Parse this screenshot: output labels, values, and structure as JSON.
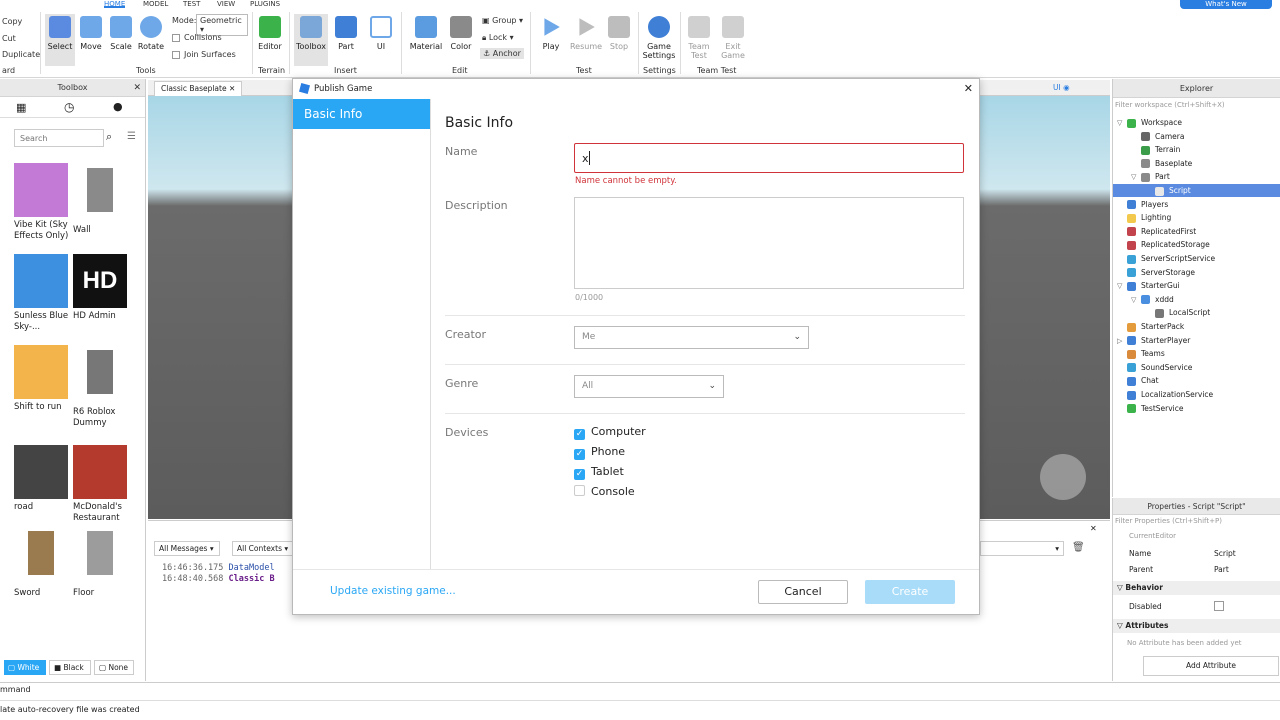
{
  "ribbon": {
    "tabs": [
      "HOME",
      "MODEL",
      "TEST",
      "VIEW",
      "PLUGINS"
    ],
    "whats_new": "What's New",
    "clipboard": {
      "copy": "Copy",
      "cut": "Cut",
      "duplicate": "Duplicate",
      "group_label": "ard"
    },
    "tools": {
      "select": "Select",
      "move": "Move",
      "scale": "Scale",
      "rotate": "Rotate",
      "mode_label": "Mode:",
      "mode_value": "Geometric",
      "collisions": "Collisions",
      "join_surfaces": "Join Surfaces",
      "group_label": "Tools"
    },
    "terrain": {
      "editor": "Editor",
      "group_label": "Terrain"
    },
    "insert": {
      "toolbox": "Toolbox",
      "part": "Part",
      "ui": "UI",
      "group_label": "Insert"
    },
    "edit": {
      "material": "Material",
      "color": "Color",
      "group": "Group",
      "lock": "Lock",
      "anchor": "Anchor",
      "group_label": "Edit"
    },
    "test": {
      "play": "Play",
      "resume": "Resume",
      "stop": "Stop",
      "group_label": "Test"
    },
    "settings": {
      "game_settings": "Game Settings",
      "group_label": "Settings"
    },
    "team_test": {
      "team_test": "Team Test",
      "exit_game": "Exit Game",
      "group_label": "Team Test"
    }
  },
  "toolbox": {
    "title": "Toolbox",
    "search_placeholder": "Search",
    "items": [
      {
        "label": "Vibe Kit (Sky Effects Only)",
        "color": "#c37ad6"
      },
      {
        "label": "Wall",
        "color": "#8a8a8a"
      },
      {
        "label": "Sunless Blue Sky-...",
        "color": "#3d8fe0"
      },
      {
        "label": "HD Admin",
        "color": "#111111"
      },
      {
        "label": "Shift to run",
        "color": "#f2b44b"
      },
      {
        "label": "R6 Roblox Dummy",
        "color": "#777777"
      },
      {
        "label": "road",
        "color": "#444444"
      },
      {
        "label": "McDonald's Restaurant",
        "color": "#b53a2e"
      },
      {
        "label": "Sword",
        "color": "#9a7b4f"
      },
      {
        "label": "Floor",
        "color": "#9c9c9c"
      }
    ],
    "hd_text": "HD",
    "bg_options": [
      "White",
      "Black",
      "None"
    ]
  },
  "viewport": {
    "tab_label": "Classic Baseplate",
    "ui_toggle": "UI"
  },
  "output": {
    "filter_messages": "All Messages",
    "filter_contexts": "All Contexts",
    "lines": [
      {
        "time": "16:46:36.175",
        "text": "DataModel"
      },
      {
        "time": "16:48:40.568",
        "text": "Classic B"
      }
    ]
  },
  "explorer": {
    "title": "Explorer",
    "filter_placeholder": "Filter workspace (Ctrl+Shift+X)",
    "items": [
      {
        "label": "Workspace",
        "depth": 0,
        "arrow": "▽",
        "color": "#3bb34a"
      },
      {
        "label": "Camera",
        "depth": 1,
        "arrow": "",
        "color": "#666666"
      },
      {
        "label": "Terrain",
        "depth": 1,
        "arrow": "",
        "color": "#3b9d4a"
      },
      {
        "label": "Baseplate",
        "depth": 1,
        "arrow": "",
        "color": "#8a8a8a"
      },
      {
        "label": "Part",
        "depth": 1,
        "arrow": "▽",
        "color": "#8a8a8a"
      },
      {
        "label": "Script",
        "depth": 2,
        "arrow": "",
        "color": "#e8e8e8",
        "selected": true
      },
      {
        "label": "Players",
        "depth": 0,
        "arrow": "",
        "color": "#3f7fd6"
      },
      {
        "label": "Lighting",
        "depth": 0,
        "arrow": "",
        "color": "#f2c94c"
      },
      {
        "label": "ReplicatedFirst",
        "depth": 0,
        "arrow": "",
        "color": "#c2434b"
      },
      {
        "label": "ReplicatedStorage",
        "depth": 0,
        "arrow": "",
        "color": "#c2434b"
      },
      {
        "label": "ServerScriptService",
        "depth": 0,
        "arrow": "",
        "color": "#3aa1d6"
      },
      {
        "label": "ServerStorage",
        "depth": 0,
        "arrow": "",
        "color": "#3aa1d6"
      },
      {
        "label": "StarterGui",
        "depth": 0,
        "arrow": "▽",
        "color": "#3f7fd6"
      },
      {
        "label": "xddd",
        "depth": 1,
        "arrow": "▽",
        "color": "#4a8ee0"
      },
      {
        "label": "LocalScript",
        "depth": 2,
        "arrow": "",
        "color": "#777777"
      },
      {
        "label": "StarterPack",
        "depth": 0,
        "arrow": "",
        "color": "#e39b3b"
      },
      {
        "label": "StarterPlayer",
        "depth": 0,
        "arrow": "▷",
        "color": "#3f7fd6"
      },
      {
        "label": "Teams",
        "depth": 0,
        "arrow": "",
        "color": "#d98a3a"
      },
      {
        "label": "SoundService",
        "depth": 0,
        "arrow": "",
        "color": "#3aa1d6"
      },
      {
        "label": "Chat",
        "depth": 0,
        "arrow": "",
        "color": "#3f7fd6"
      },
      {
        "label": "LocalizationService",
        "depth": 0,
        "arrow": "",
        "color": "#3f7fd6"
      },
      {
        "label": "TestService",
        "depth": 0,
        "arrow": "",
        "color": "#3bb34a"
      }
    ]
  },
  "properties": {
    "title": "Properties - Script \"Script\"",
    "filter_placeholder": "Filter Properties (Ctrl+Shift+P)",
    "current_editor": "CurrentEditor",
    "rows": [
      {
        "name": "Name",
        "value": "Script"
      },
      {
        "name": "Parent",
        "value": "Part"
      }
    ],
    "behavior": "Behavior",
    "disabled": "Disabled",
    "attributes": "Attributes",
    "no_attr": "No Attribute has been added yet",
    "add_attr": "Add Attribute"
  },
  "command_bar": "mmand",
  "status_bar": "late auto-recovery file was created",
  "dialog": {
    "title": "Publish Game",
    "sidebar_selected": "Basic Info",
    "heading": "Basic Info",
    "name_label": "Name",
    "name_value": "x",
    "name_error": "Name cannot be empty.",
    "description_label": "Description",
    "description_counter": "0/1000",
    "creator_label": "Creator",
    "creator_value": "Me",
    "genre_label": "Genre",
    "genre_value": "All",
    "devices_label": "Devices",
    "devices": [
      {
        "label": "Computer",
        "checked": true
      },
      {
        "label": "Phone",
        "checked": true
      },
      {
        "label": "Tablet",
        "checked": true
      },
      {
        "label": "Console",
        "checked": false
      }
    ],
    "update_link": "Update existing game...",
    "cancel": "Cancel",
    "create": "Create",
    "colors": {
      "accent": "#2aa7f4",
      "error": "#d0343a",
      "create_disabled": "#a8dcf9"
    }
  }
}
